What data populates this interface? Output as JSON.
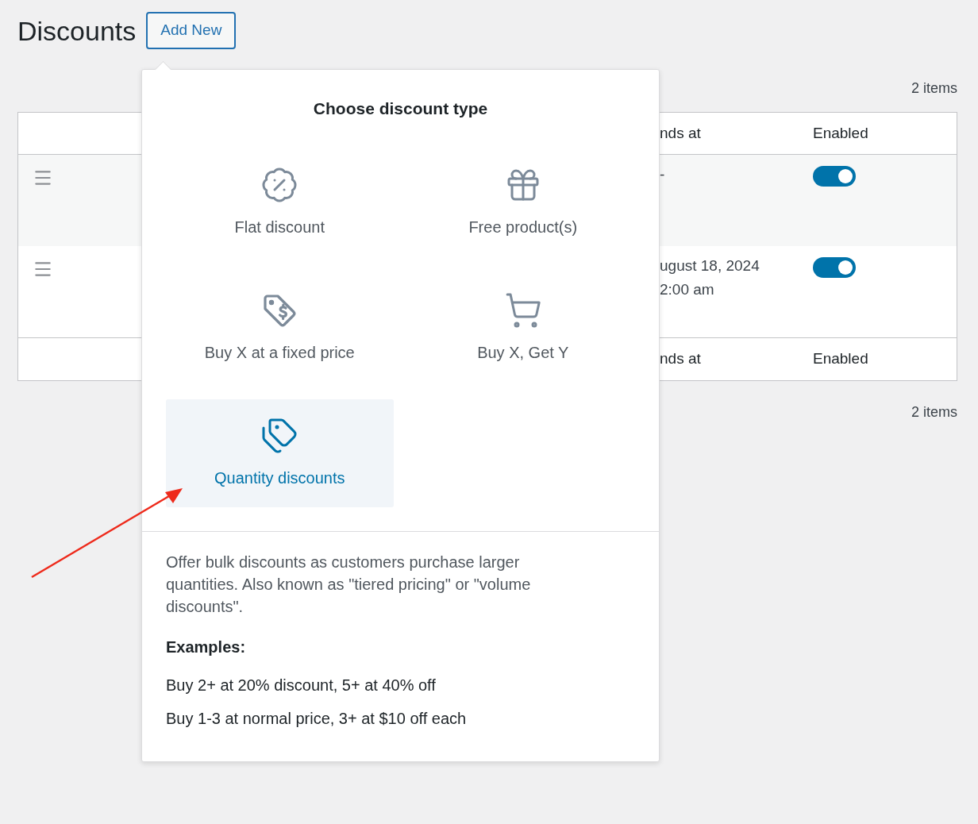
{
  "page": {
    "title": "Discounts",
    "add_button": "Add New"
  },
  "items_count_top": "2 items",
  "table": {
    "header": [
      "nds at",
      "Enabled"
    ],
    "rows": [
      {
        "ends_at": [
          "-"
        ],
        "enabled": true
      },
      {
        "ends_at": [
          "ugust 18, 2024",
          "2:00 am"
        ],
        "enabled": true
      }
    ],
    "footer": [
      "nds at",
      "Enabled"
    ]
  },
  "items_count_bottom": "2 items",
  "popover": {
    "title": "Choose discount type",
    "options": [
      {
        "kind": "percent",
        "label": "Flat discount",
        "selected": false
      },
      {
        "kind": "gift",
        "label": "Free product(s)",
        "selected": false
      },
      {
        "kind": "price-tag",
        "label": "Buy X at a fixed price",
        "selected": false
      },
      {
        "kind": "cart",
        "label": "Buy X, Get Y",
        "selected": false
      },
      {
        "kind": "tags",
        "label": "Quantity discounts",
        "selected": true
      }
    ],
    "description": "Offer bulk discounts as customers purchase larger quantities. Also known as \"tiered pricing\" or \"volume discounts\".",
    "examples_heading": "Examples:",
    "examples": [
      "Buy 2+ at 20% discount, 5+ at 40% off",
      "Buy 1-3 at normal price, 3+ at $10 off each"
    ]
  }
}
